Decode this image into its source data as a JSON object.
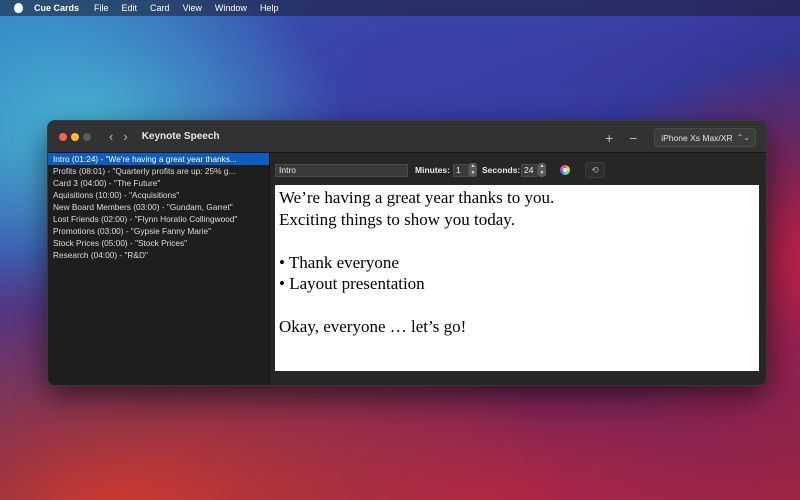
{
  "menubar": {
    "app_name": "Cue Cards",
    "items": [
      "File",
      "Edit",
      "Card",
      "View",
      "Window",
      "Help"
    ]
  },
  "window": {
    "title": "Keynote Speech",
    "device_selector": "iPhone Xs Max/XR"
  },
  "sidebar": {
    "items": [
      "Intro (01:24) - \"We're having a great year thanks...",
      "Profits (08:01) - \"Quarterly profits are up: 25% g...",
      "Card 3 (04:00) - \"The Future\"",
      "Aquisitions (10:00) - \"Acquisitions\"",
      "New Board Members (03:00) - \"Gundam, Garret\"",
      "Lost Friends (02:00) - \"Flynn Horatio Collingwood\"",
      "Promotions (03:00) - \"Gypsie Fanny Marie\"",
      "Stock Prices (05:00) - \"Stock Prices\"",
      "Research (04:00) - \"R&D\""
    ],
    "selected_index": 0
  },
  "editor": {
    "card_name": "Intro",
    "minutes_label": "Minutes:",
    "minutes_value": "1",
    "seconds_label": "Seconds:",
    "seconds_value": "24",
    "card_text": [
      "We’re having a great year thanks to you.",
      "Exciting things to show you today.",
      "",
      "• Thank everyone",
      "• Layout presentation",
      "",
      "Okay, everyone … let’s go!"
    ]
  },
  "colors": {
    "selection": "#0f5cc0",
    "window_bg": "#1e1e1e",
    "card_bg": "#ffffff"
  }
}
